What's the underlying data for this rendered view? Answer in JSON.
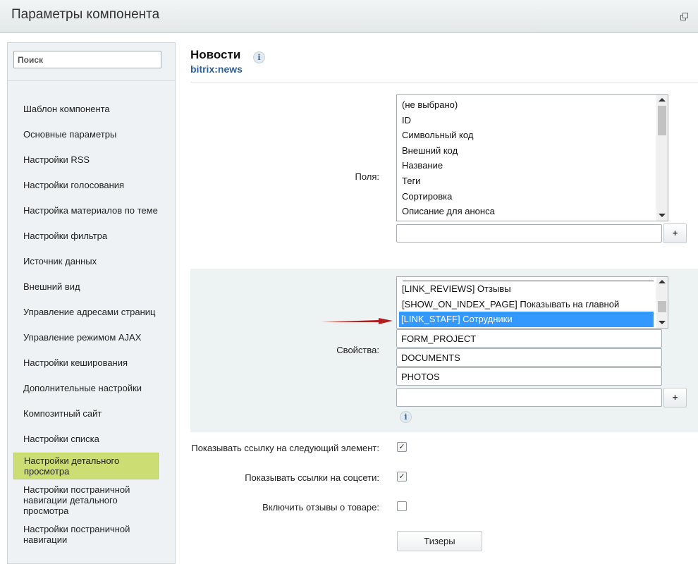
{
  "window": {
    "title": "Параметры компонента",
    "restore_icon": "restore-window-icon"
  },
  "sidebar": {
    "search_placeholder": "Поиск",
    "items": [
      "Шаблон компонента",
      "Основные параметры",
      "Настройки RSS",
      "Настройки голосования",
      "Настройка материалов по теме",
      "Настройки фильтра",
      "Источник данных",
      "Внешний вид",
      "Управление адресами страниц",
      "Управление режимом AJAX",
      "Настройки кеширования",
      "Дополнительные настройки",
      "Композитный сайт",
      "Настройки списка",
      "Настройки детального просмотра",
      "Настройки постраничной навигации детального просмотра",
      "Настройки постраничной навигации"
    ],
    "active_item": "Настройки детального просмотра"
  },
  "component": {
    "title": "Новости",
    "code": "bitrix:news",
    "info_icon": "info-icon"
  },
  "fields": {
    "label": "Поля:",
    "options": [
      "(не выбрано)",
      "ID",
      "Символьный код",
      "Внешний код",
      "Название",
      "Теги",
      "Сортировка",
      "Описание для анонса"
    ],
    "new_value": "",
    "add_label": "+"
  },
  "properties": {
    "label": "Свойства:",
    "options": [
      "[LINK_REVIEWS] Отзывы",
      "[SHOW_ON_INDEX_PAGE] Показывать на главной",
      "[LINK_STAFF] Сотрудники"
    ],
    "selected": "[LINK_STAFF] Сотрудники",
    "inputs": [
      "FORM_PROJECT",
      "DOCUMENTS",
      "PHOTOS",
      ""
    ],
    "add_label": "+"
  },
  "options": {
    "show_next_link": {
      "label": "Показывать ссылку на следующий элемент:",
      "checked": true
    },
    "show_social_links": {
      "label": "Показывать ссылки на соцсети:",
      "checked": true
    },
    "enable_reviews": {
      "label": "Включить отзывы о товаре:",
      "checked": false
    }
  },
  "teasers_button": "Тизеры",
  "colors": {
    "accent_active": "#ccdd73",
    "link": "#2d5f96",
    "selection": "#3399ff",
    "arrow": "#b31d1d"
  }
}
